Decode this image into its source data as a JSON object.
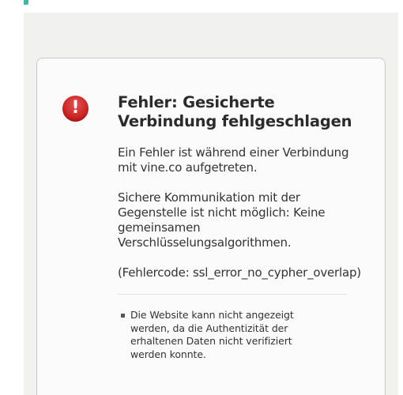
{
  "error_page": {
    "title": "Fehler: Gesicherte Verbindung fehlgeschlagen",
    "paragraph_1": "Ein Fehler ist während einer Verbindung mit vine.co aufgetreten.",
    "paragraph_2": "Sichere Kommunikation mit der Gegenstelle ist nicht möglich: Keine gemeinsamen Verschlüsselungsalgorithmen.",
    "error_code": "(Fehlercode: ssl_error_no_cypher_overlap)",
    "reasons": [
      "Die Website kann nicht angezeigt werden, da die Authentizität der erhaltenen Daten nicht verifiziert werden konnte."
    ],
    "icon": "exclamation-alert-icon",
    "icon_glyph": "!",
    "colors": {
      "icon": "#c91f1f",
      "accent": "#3fb7a2",
      "viewport_bg": "#f1f1ef",
      "card_bg": "#fbfbfb"
    }
  }
}
